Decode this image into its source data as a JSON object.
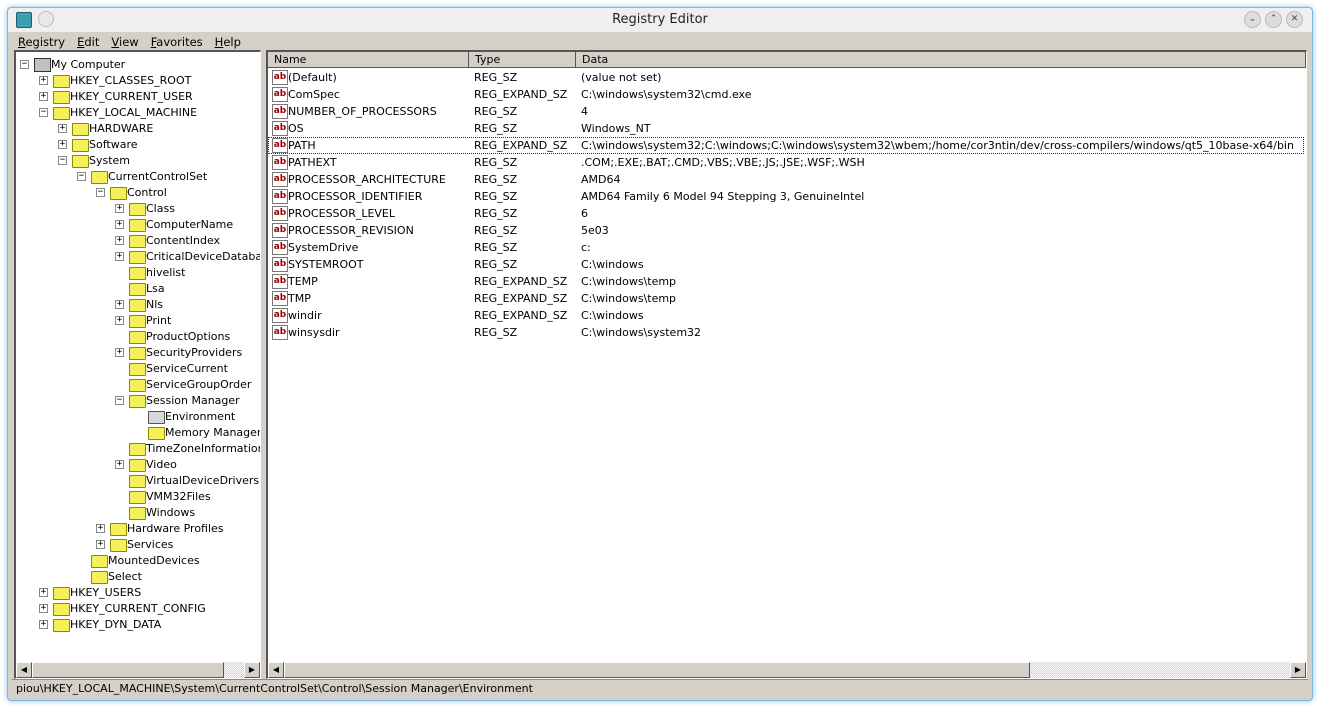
{
  "window": {
    "title": "Registry Editor",
    "min": "⌄",
    "max": "⌃",
    "close": "✕"
  },
  "menu": [
    {
      "label": "Registry",
      "u": "R",
      "rest": "egistry"
    },
    {
      "label": "Edit",
      "u": "E",
      "rest": "dit"
    },
    {
      "label": "View",
      "u": "V",
      "rest": "iew"
    },
    {
      "label": "Favorites",
      "u": "F",
      "rest": "avorites"
    },
    {
      "label": "Help",
      "u": "H",
      "rest": "elp"
    }
  ],
  "tree": [
    {
      "label": "My Computer",
      "level": 0,
      "exp": "-",
      "icon": "computer"
    },
    {
      "label": "HKEY_CLASSES_ROOT",
      "level": 1,
      "exp": "+"
    },
    {
      "label": "HKEY_CURRENT_USER",
      "level": 1,
      "exp": "+"
    },
    {
      "label": "HKEY_LOCAL_MACHINE",
      "level": 1,
      "exp": "-"
    },
    {
      "label": "HARDWARE",
      "level": 2,
      "exp": "+"
    },
    {
      "label": "Software",
      "level": 2,
      "exp": "+"
    },
    {
      "label": "System",
      "level": 2,
      "exp": "-"
    },
    {
      "label": "CurrentControlSet",
      "level": 3,
      "exp": "-"
    },
    {
      "label": "Control",
      "level": 4,
      "exp": "-"
    },
    {
      "label": "Class",
      "level": 5,
      "exp": "+"
    },
    {
      "label": "ComputerName",
      "level": 5,
      "exp": "+"
    },
    {
      "label": "ContentIndex",
      "level": 5,
      "exp": "+"
    },
    {
      "label": "CriticalDeviceDatabase",
      "level": 5,
      "exp": "+"
    },
    {
      "label": "hivelist",
      "level": 5,
      "exp": ""
    },
    {
      "label": "Lsa",
      "level": 5,
      "exp": ""
    },
    {
      "label": "Nls",
      "level": 5,
      "exp": "+"
    },
    {
      "label": "Print",
      "level": 5,
      "exp": "+"
    },
    {
      "label": "ProductOptions",
      "level": 5,
      "exp": ""
    },
    {
      "label": "SecurityProviders",
      "level": 5,
      "exp": "+"
    },
    {
      "label": "ServiceCurrent",
      "level": 5,
      "exp": ""
    },
    {
      "label": "ServiceGroupOrder",
      "level": 5,
      "exp": ""
    },
    {
      "label": "Session Manager",
      "level": 5,
      "exp": "-"
    },
    {
      "label": "Environment",
      "level": 6,
      "exp": "",
      "icon": "open",
      "selected": true
    },
    {
      "label": "Memory Management",
      "level": 6,
      "exp": ""
    },
    {
      "label": "TimeZoneInformation",
      "level": 5,
      "exp": ""
    },
    {
      "label": "Video",
      "level": 5,
      "exp": "+"
    },
    {
      "label": "VirtualDeviceDrivers",
      "level": 5,
      "exp": ""
    },
    {
      "label": "VMM32Files",
      "level": 5,
      "exp": ""
    },
    {
      "label": "Windows",
      "level": 5,
      "exp": ""
    },
    {
      "label": "Hardware Profiles",
      "level": 4,
      "exp": "+"
    },
    {
      "label": "Services",
      "level": 4,
      "exp": "+"
    },
    {
      "label": "MountedDevices",
      "level": 3,
      "exp": ""
    },
    {
      "label": "Select",
      "level": 3,
      "exp": ""
    },
    {
      "label": "HKEY_USERS",
      "level": 1,
      "exp": "+"
    },
    {
      "label": "HKEY_CURRENT_CONFIG",
      "level": 1,
      "exp": "+"
    },
    {
      "label": "HKEY_DYN_DATA",
      "level": 1,
      "exp": "+"
    }
  ],
  "columns": [
    "Name",
    "Type",
    "Data"
  ],
  "values": [
    [
      "(Default)",
      "REG_SZ",
      "(value not set)"
    ],
    [
      "ComSpec",
      "REG_EXPAND_SZ",
      "C:\\windows\\system32\\cmd.exe"
    ],
    [
      "NUMBER_OF_PROCESSORS",
      "REG_SZ",
      "4"
    ],
    [
      "OS",
      "REG_SZ",
      "Windows_NT"
    ],
    [
      "PATH",
      "REG_EXPAND_SZ",
      "C:\\windows\\system32;C:\\windows;C:\\windows\\system32\\wbem;/home/cor3ntin/dev/cross-compilers/windows/qt5_10base-x64/bin"
    ],
    [
      "PATHEXT",
      "REG_SZ",
      ".COM;.EXE;.BAT;.CMD;.VBS;.VBE;.JS;.JSE;.WSF;.WSH"
    ],
    [
      "PROCESSOR_ARCHITECTURE",
      "REG_SZ",
      "AMD64"
    ],
    [
      "PROCESSOR_IDENTIFIER",
      "REG_SZ",
      "AMD64 Family 6 Model 94 Stepping 3, GenuineIntel"
    ],
    [
      "PROCESSOR_LEVEL",
      "REG_SZ",
      "6"
    ],
    [
      "PROCESSOR_REVISION",
      "REG_SZ",
      "5e03"
    ],
    [
      "SystemDrive",
      "REG_SZ",
      "c:"
    ],
    [
      "SYSTEMROOT",
      "REG_SZ",
      "C:\\windows"
    ],
    [
      "TEMP",
      "REG_EXPAND_SZ",
      "C:\\windows\\temp"
    ],
    [
      "TMP",
      "REG_EXPAND_SZ",
      "C:\\windows\\temp"
    ],
    [
      "windir",
      "REG_EXPAND_SZ",
      "C:\\windows"
    ],
    [
      "winsysdir",
      "REG_SZ",
      "C:\\windows\\system32"
    ]
  ],
  "focused_row": "PATH",
  "value_icon": "ab",
  "status": "piou\\HKEY_LOCAL_MACHINE\\System\\CurrentControlSet\\Control\\Session Manager\\Environment"
}
